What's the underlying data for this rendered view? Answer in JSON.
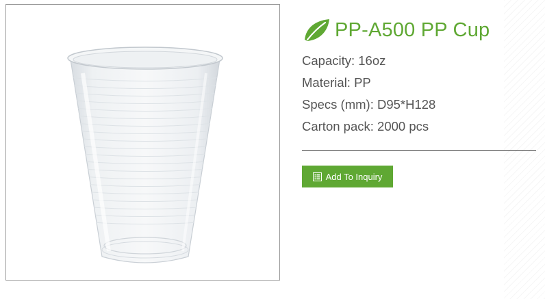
{
  "product": {
    "title": "PP-A500 PP Cup",
    "image_alt": "Clear PP plastic cup",
    "icon": "leaf-icon",
    "accent_color": "#5fa833"
  },
  "specs": [
    {
      "label": "Capacity:",
      "value": "16oz",
      "text": "Capacity: 16oz"
    },
    {
      "label": "Material:",
      "value": "PP",
      "text": "Material: PP"
    },
    {
      "label": "Specs (mm):",
      "value": "D95*H128",
      "text": "Specs (mm): D95*H128"
    },
    {
      "label": "Carton pack:",
      "value": "2000 pcs",
      "text": "Carton pack: 2000 pcs"
    }
  ],
  "actions": {
    "inquiry_label": "Add To Inquiry",
    "inquiry_icon": "list-icon"
  }
}
